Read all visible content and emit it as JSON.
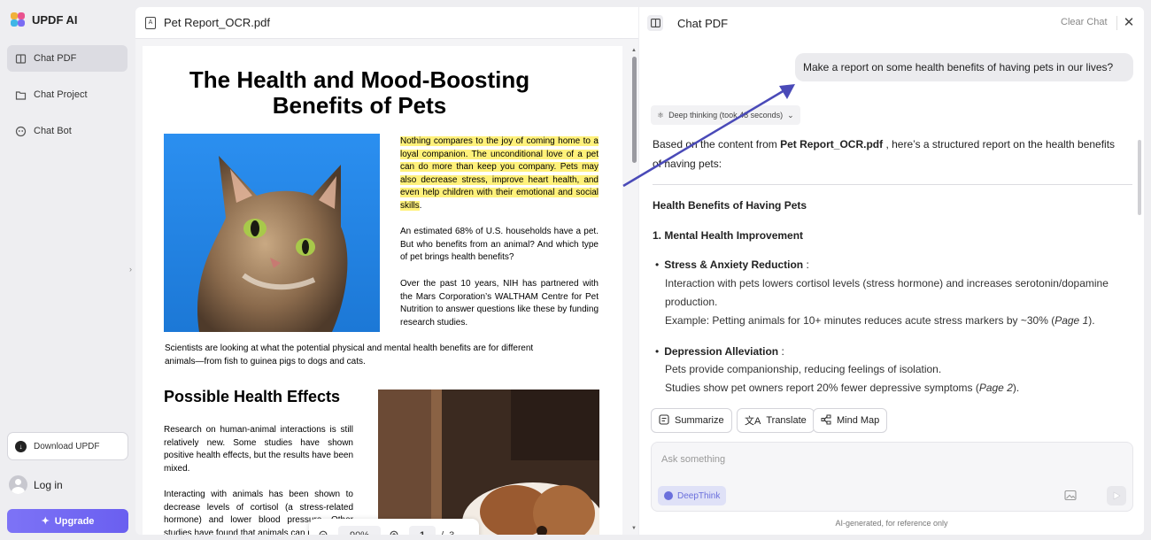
{
  "sidebar": {
    "brand": "UPDF AI",
    "items": [
      {
        "label": "Chat PDF",
        "active": true
      },
      {
        "label": "Chat Project",
        "active": false
      },
      {
        "label": "Chat Bot",
        "active": false
      }
    ],
    "download_label": "Download UPDF",
    "login_label": "Log in",
    "upgrade_label": "Upgrade"
  },
  "pdf": {
    "filename": "Pet Report_OCR.pdf",
    "title_line1": "The Health and Mood-Boosting",
    "title_line2": "Benefits of Pets",
    "highlight_para": "Nothing compares to the joy of coming home to a loyal companion. The unconditional love of a pet can do more than keep you company. Pets may also decrease stress, improve heart health, and even help children with their emotional and social skills",
    "highlight_tail": ".",
    "para2": "An estimated 68% of U.S. households have a pet. But who benefits from an animal? And which type of pet brings health benefits?",
    "para3": "Over the past 10 years, NIH has partnered with the Mars Corporation’s WALTHAM Centre for Pet Nutrition to answer questions like these by funding research studies.",
    "para4": "Scientists are looking at what the potential physical and mental health benefits are for different animals—from fish to guinea pigs to dogs and cats.",
    "section_heading": "Possible Health Effects",
    "para5": "Research on human-animal interactions is still relatively new. Some studies have shown positive health effects, but the results have been mixed.",
    "para6": "Interacting with animals has been shown to decrease levels of cortisol (a stress-related hormone) and lower blood pressure. Other studies have found that animals can reduce"
  },
  "zoom": {
    "zoom_level": "90%",
    "current_page": "1",
    "page_sep": "/",
    "total_pages": "3"
  },
  "chat": {
    "title": "Chat PDF",
    "clear_label": "Clear Chat",
    "user_message": "Make a report on some health benefits of having pets in our lives?",
    "deep_thinking_label": "Deep thinking (took 48 seconds)",
    "intro_prefix": "Based on the content from ",
    "intro_file": "Pet Report_OCR.pdf",
    "intro_suffix": " , here’s a structured report on the health benefits of having pets:",
    "report_heading": "Health Benefits of Having Pets",
    "section1_heading": "1. Mental Health Improvement",
    "bullet1_title": "Stress & Anxiety Reduction",
    "bullet1_colon": " :",
    "bullet1_line1": "Interaction with pets lowers cortisol levels (stress hormone) and increases serotonin/dopamine",
    "bullet1_line2": "production.",
    "bullet1_example_prefix": "Example: Petting animals for 10+ minutes reduces acute stress markers by ~30% (",
    "bullet1_example_ref": "Page 1",
    "bullet1_example_suffix": ").",
    "bullet2_title": "Depression Alleviation",
    "bullet2_colon": " :",
    "bullet2_line1": "Pets provide companionship, reducing feelings of isolation.",
    "bullet2_line2_prefix": "Studies show pet owners report 20% fewer depressive symptoms (",
    "bullet2_line2_ref": "Page 2",
    "bullet2_line2_suffix": ").",
    "actions": [
      "Summarize",
      "Translate",
      "Mind Map"
    ],
    "input_placeholder": "Ask something",
    "deepthink_label": "DeepThink",
    "footnote": "AI-generated, for reference only"
  },
  "colors": {
    "accent": "#6a5ff0",
    "highlight": "#fff17a",
    "arrow": "#4a4ab8"
  }
}
